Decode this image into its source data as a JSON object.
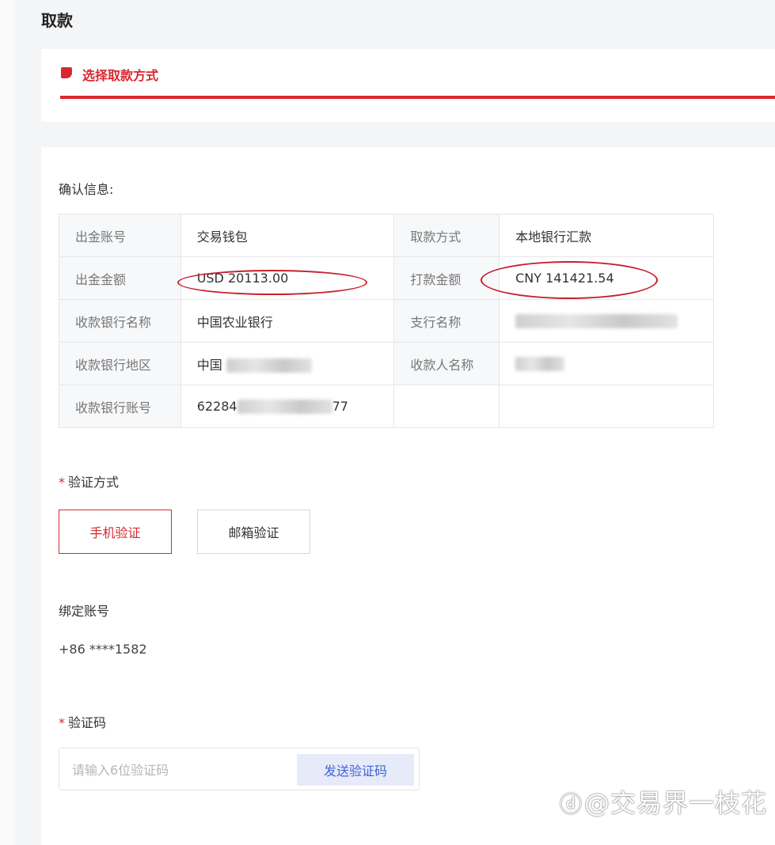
{
  "page": {
    "title": "取款"
  },
  "step": {
    "label": "选择取款方式",
    "accent_color": "#d8282f"
  },
  "confirm": {
    "title": "确认信息:",
    "rows": [
      {
        "l1": "出金账号",
        "v1": "交易钱包",
        "l2": "取款方式",
        "v2": "本地银行汇款"
      },
      {
        "l1": "出金金额",
        "v1": "USD 20113.00",
        "l2": "打款金额",
        "v2": "CNY 141421.54"
      },
      {
        "l1": "收款银行名称",
        "v1": "中国农业银行",
        "l2": "支行名称",
        "v2": ""
      },
      {
        "l1": "收款银行地区",
        "v1": "中国",
        "l2": "收款人名称",
        "v2": ""
      },
      {
        "l1": "收款银行账号",
        "v1": "62284",
        "v1_tail": "77",
        "l2": "",
        "v2": ""
      }
    ]
  },
  "verify": {
    "required_mark": "*",
    "title": "验证方式",
    "options": [
      {
        "label": "手机验证",
        "selected": true
      },
      {
        "label": "邮箱验证",
        "selected": false
      }
    ]
  },
  "bound": {
    "label": "绑定账号",
    "value": "+86 ****1582"
  },
  "code": {
    "title": "验证码",
    "placeholder": "请输入6位验证码",
    "send_label": "发送验证码"
  },
  "watermark": {
    "icon": "zhihu-icon",
    "text": "@交易界一枝花"
  }
}
